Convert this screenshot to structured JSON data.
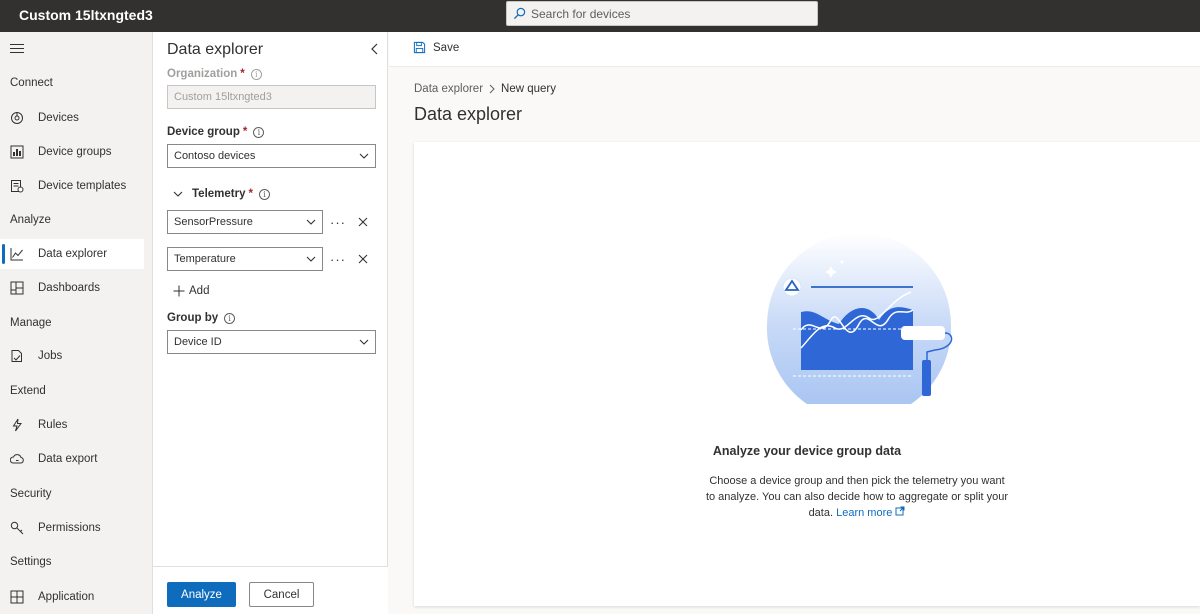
{
  "app": {
    "title": "Custom 15ltxngted3"
  },
  "search": {
    "placeholder": "Search for devices"
  },
  "nav": {
    "sections": {
      "connect": "Connect",
      "analyze": "Analyze",
      "manage": "Manage",
      "extend": "Extend",
      "security": "Security",
      "settings": "Settings"
    },
    "items": {
      "devices": "Devices",
      "device_groups": "Device groups",
      "device_templates": "Device templates",
      "data_explorer": "Data explorer",
      "dashboards": "Dashboards",
      "jobs": "Jobs",
      "rules": "Rules",
      "data_export": "Data export",
      "permissions": "Permissions",
      "application": "Application"
    },
    "active": "data_explorer"
  },
  "panel": {
    "title": "Data explorer",
    "organization": {
      "label": "Organization",
      "value": "Custom 15ltxngted3"
    },
    "device_group": {
      "label": "Device group",
      "value": "Contoso devices"
    },
    "telemetry": {
      "label": "Telemetry",
      "items": [
        "SensorPressure",
        "Temperature"
      ],
      "more": "···"
    },
    "add_label": "Add",
    "group_by": {
      "label": "Group by",
      "value": "Device ID"
    },
    "required_mark": "*",
    "info_glyph": "i",
    "analyze_label": "Analyze",
    "cancel_label": "Cancel"
  },
  "commandbar": {
    "save_label": "Save"
  },
  "main": {
    "breadcrumb": {
      "root": "Data explorer",
      "current": "New query"
    },
    "title": "Data explorer",
    "empty_state": {
      "title": "Analyze your device group data",
      "description": "Choose a device group and then pick the telemetry you want to analyze. You can also decide how to aggregate or split your data.",
      "link": "Learn more"
    }
  },
  "colors": {
    "topbar": "#323130",
    "accent": "#0f6cbd",
    "required": "#a4262c"
  }
}
